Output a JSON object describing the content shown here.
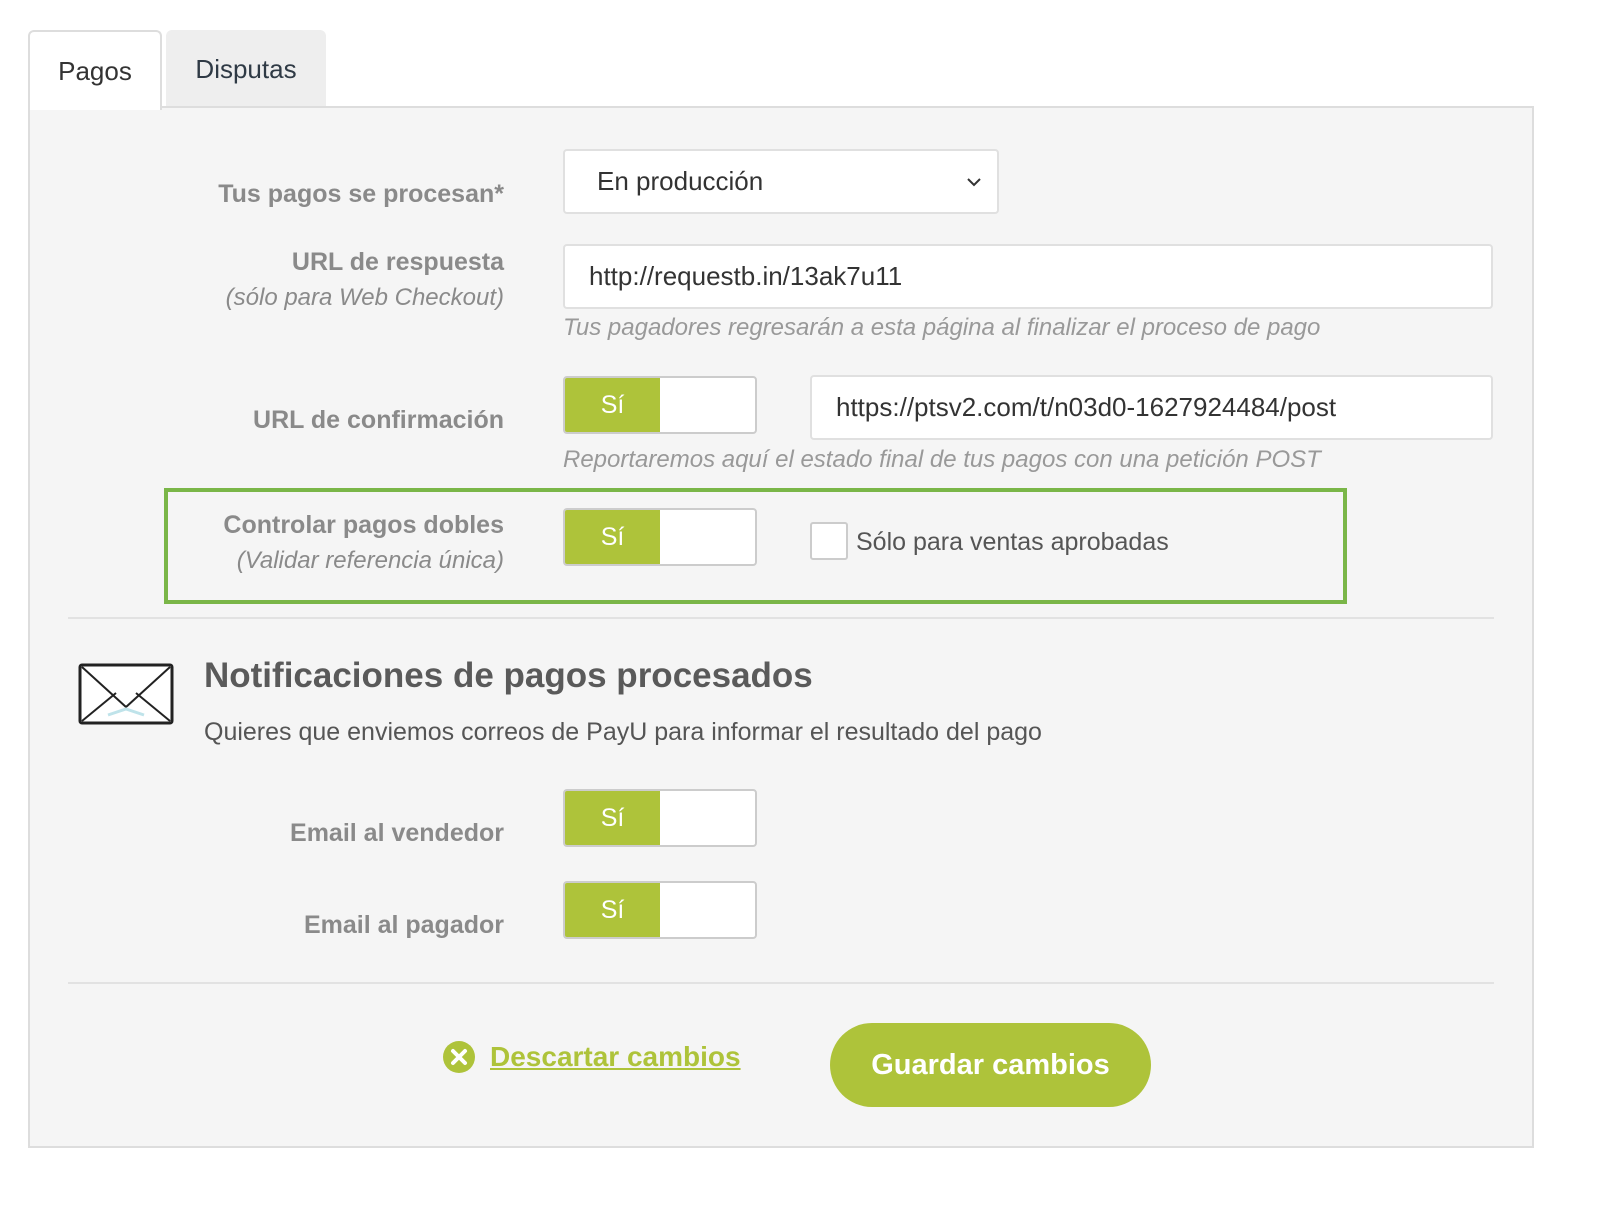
{
  "tabs": [
    {
      "label": "Pagos",
      "active": true
    },
    {
      "label": "Disputas",
      "active": false
    }
  ],
  "payments_mode": {
    "label": "Tus pagos se procesan*",
    "selected": "En producción"
  },
  "response_url": {
    "label": "URL de respuesta",
    "sublabel": "(sólo para Web Checkout)",
    "value": "http://requestb.in/13ak7u11",
    "help": "Tus pagadores regresarán a esta página al finalizar el proceso de pago"
  },
  "confirmation_url": {
    "label": "URL de confirmación",
    "toggle_label": "Sí",
    "enabled": true,
    "value": "https://ptsv2.com/t/n03d0-1627924484/post",
    "help": "Reportaremos aquí el estado final de tus pagos con una petición POST"
  },
  "double_payments": {
    "label": "Controlar pagos dobles",
    "sublabel": "(Validar referencia única)",
    "toggle_label": "Sí",
    "enabled": true,
    "checkbox_label": "Sólo para ventas aprobadas",
    "checkbox_checked": false
  },
  "notifications": {
    "icon": "envelope-icon",
    "title": "Notificaciones de pagos procesados",
    "description": "Quieres que enviemos correos de PayU para informar el resultado del pago",
    "seller_email": {
      "label": "Email al vendedor",
      "toggle_label": "Sí",
      "enabled": true
    },
    "payer_email": {
      "label": "Email al pagador",
      "toggle_label": "Sí",
      "enabled": true
    }
  },
  "actions": {
    "discard_label": "Descartar cambios",
    "save_label": "Guardar cambios"
  },
  "colors": {
    "accent": "#aec33a",
    "highlight_border": "#7ab648",
    "panel_bg": "#f5f5f5"
  }
}
